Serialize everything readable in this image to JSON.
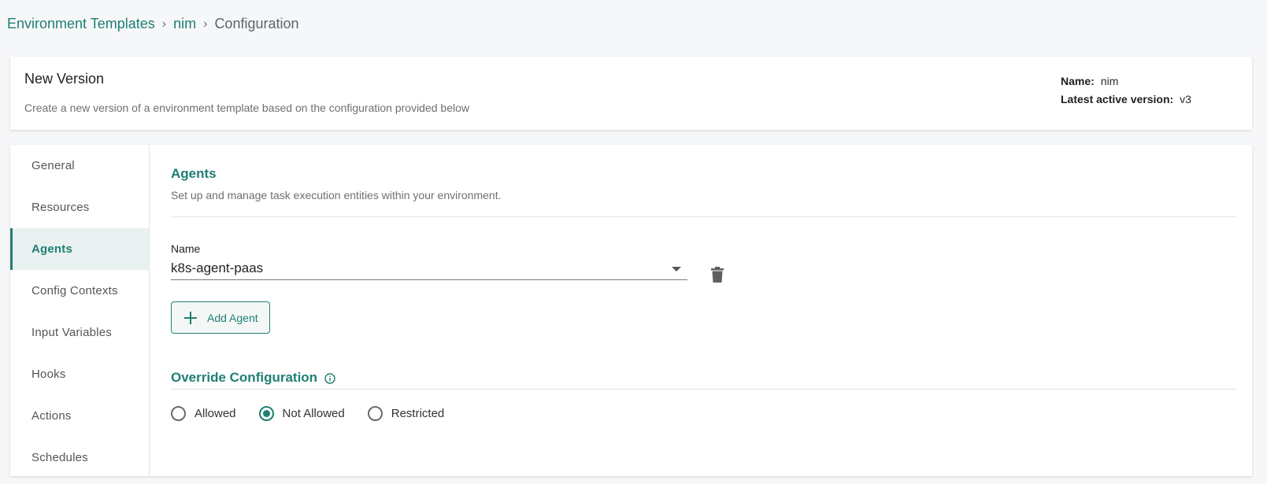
{
  "breadcrumb": {
    "items": [
      "Environment Templates",
      "nim",
      "Configuration"
    ],
    "separator": "›"
  },
  "header": {
    "title": "New Version",
    "subtitle": "Create a new version of a environment template based on the configuration provided below",
    "name_label": "Name:",
    "name_value": "nim",
    "version_label": "Latest active version:",
    "version_value": "v3"
  },
  "sidebar": {
    "items": [
      {
        "label": "General"
      },
      {
        "label": "Resources"
      },
      {
        "label": "Agents"
      },
      {
        "label": "Config Contexts"
      },
      {
        "label": "Input Variables"
      },
      {
        "label": "Hooks"
      },
      {
        "label": "Actions"
      },
      {
        "label": "Schedules"
      }
    ],
    "active_index": 2
  },
  "agents": {
    "title": "Agents",
    "description": "Set up and manage task execution entities within your environment.",
    "name_label": "Name",
    "name_value": "k8s-agent-paas",
    "add_button_label": "Add Agent"
  },
  "override": {
    "title": "Override Configuration",
    "options": [
      {
        "label": "Allowed",
        "checked": false
      },
      {
        "label": "Not Allowed",
        "checked": true
      },
      {
        "label": "Restricted",
        "checked": false
      }
    ]
  },
  "colors": {
    "accent": "#1e7f72",
    "active_nav_bg": "#e8f1ef",
    "page_bg": "#f6f7f9"
  },
  "icons": {
    "delete": "trash-icon",
    "add": "plus-icon",
    "info": "info-icon",
    "dropdown": "caret-down-icon"
  }
}
